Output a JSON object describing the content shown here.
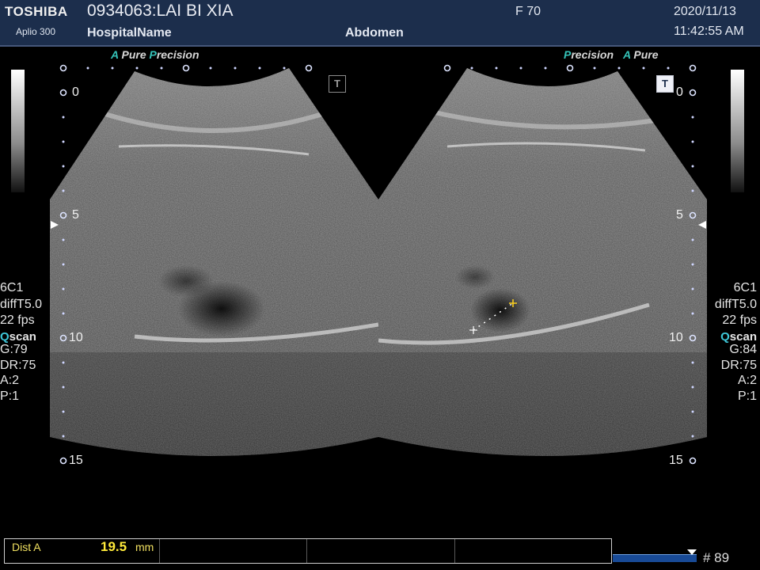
{
  "header": {
    "brand": "TOSHIBA",
    "model": "Aplio 300",
    "patient": "0934063:LAI BI XIA",
    "hospital": "HospitalName",
    "region": "Abdomen",
    "frame_rate_label": "F  70",
    "date": "2020/11/13",
    "time": "11:42:55 AM"
  },
  "left_panel": {
    "label_a": "A",
    "label_pure": "Pure",
    "label_p": "P",
    "label_precision": "recision",
    "depth_ticks": [
      "0",
      "5",
      "10",
      "15"
    ],
    "t_label": "T",
    "params": {
      "probe": "6C1",
      "mode": "diffT5.0",
      "fps": "22 fps",
      "q": "Q",
      "scan": "scan",
      "gain": "G:79",
      "dr": "DR:75",
      "a": "A:2",
      "p": "P:1"
    }
  },
  "right_panel": {
    "label_p": "P",
    "label_precision": "recision",
    "label_a": "A",
    "label_pure": "Pure",
    "depth_ticks": [
      "0",
      "5",
      "10",
      "15"
    ],
    "t_label": "T",
    "params": {
      "probe": "6C1",
      "mode": "diffT5.0",
      "fps": "22 fps",
      "q": "Q",
      "scan": "scan",
      "gain": "G:84",
      "dr": "DR:75",
      "a": "A:2",
      "p": "P:1"
    }
  },
  "measurement": {
    "label": "Dist A",
    "value": "19.5",
    "unit": "mm"
  },
  "cine": {
    "frame": "# 89",
    "progress": 1.0
  },
  "colors": {
    "header_bg": "#1c2e4c",
    "accent_teal": "#35c3b9",
    "measure_yellow": "#ffea3a",
    "progress_blue": "#184a96"
  }
}
